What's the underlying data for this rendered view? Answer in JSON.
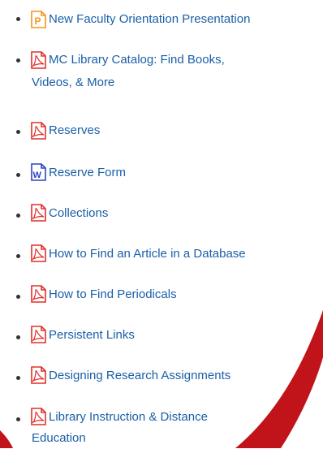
{
  "items": [
    {
      "label": "New Faculty Orientation Presentation",
      "icon": "powerpoint-file-icon",
      "color": "#f7941d"
    },
    {
      "label": "MC Library Catalog: Find Books,",
      "label2": "Videos, & More",
      "icon": "pdf-file-icon",
      "color": "#e0302b"
    },
    {
      "label": "Reserves",
      "icon": "pdf-file-icon",
      "color": "#e0302b"
    },
    {
      "label": "Reserve Form",
      "icon": "word-file-icon",
      "color": "#2b44c4"
    },
    {
      "label": "Collections",
      "icon": "pdf-file-icon",
      "color": "#e0302b"
    },
    {
      "label": "How to Find an Article in a Database",
      "icon": "pdf-file-icon",
      "color": "#e0302b"
    },
    {
      "label": "How to Find Periodicals",
      "icon": "pdf-file-icon",
      "color": "#e0302b"
    },
    {
      "label": "Persistent Links",
      "icon": "pdf-file-icon",
      "color": "#e0302b"
    },
    {
      "label": "Designing Research Assignments",
      "icon": "pdf-file-icon",
      "color": "#e0302b"
    },
    {
      "label": "Library Instruction & Distance",
      "label2": "Education",
      "icon": "pdf-file-icon",
      "color": "#e0302b"
    }
  ],
  "theme": {
    "link": "#1a5fa8",
    "swoosh": "#c0141a"
  }
}
